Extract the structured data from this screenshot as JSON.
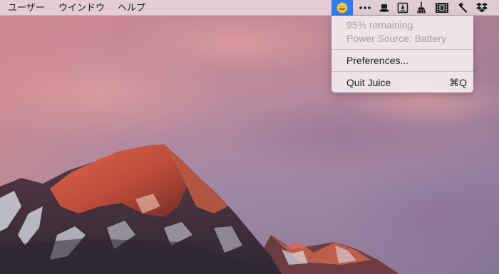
{
  "menubar": {
    "menus": [
      "ユーザー",
      "ウインドウ",
      "ヘルプ"
    ]
  },
  "status_icons": [
    {
      "name": "juice-emoji-icon",
      "active": true
    },
    {
      "name": "ellipsis-icon"
    },
    {
      "name": "top-hat-icon"
    },
    {
      "name": "download-box-icon"
    },
    {
      "name": "broom-icon"
    },
    {
      "name": "film-strip-icon"
    },
    {
      "name": "hammer-icon"
    },
    {
      "name": "dropbox-icon"
    }
  ],
  "dropdown": {
    "battery_remaining": "95% remaining",
    "power_source": "Power Source: Battery",
    "preferences": "Preferences...",
    "quit_label": "Quit Juice",
    "quit_shortcut": "⌘Q"
  },
  "colors": {
    "menubar_bg": "#ebe2e7",
    "highlight": "#2f7df1",
    "disabled_text": "#a7a1a5"
  }
}
